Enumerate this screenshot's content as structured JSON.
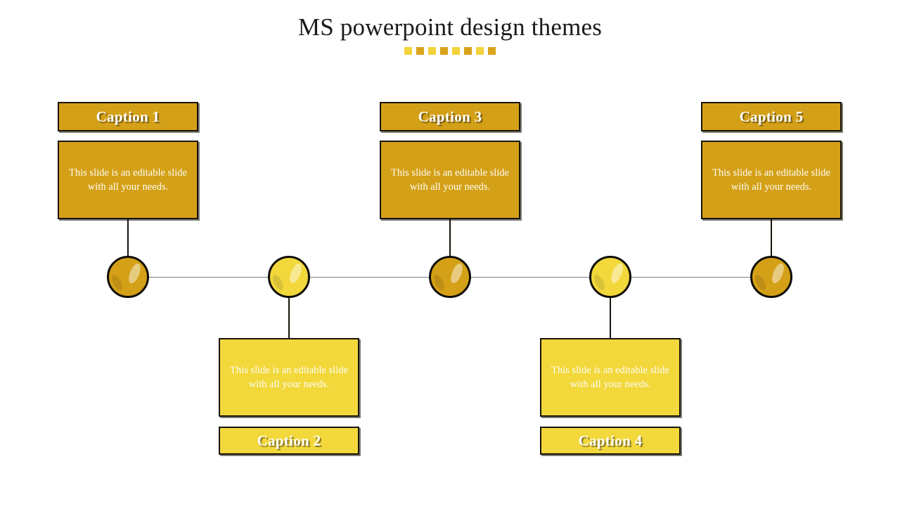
{
  "slide": {
    "title": "MS powerpoint design themes",
    "background": "#FFFFFF",
    "accent_dark": "#D4A017",
    "accent_light": "#F2D83B",
    "outline": "#191407",
    "axis_color": "#7C7C7C",
    "title_color": "#1A1A1A"
  },
  "title_dots": [
    {
      "color": "#F2D33C"
    },
    {
      "color": "#D9A41C"
    },
    {
      "color": "#F2D33C"
    },
    {
      "color": "#D9A41C"
    },
    {
      "color": "#F2D33C"
    },
    {
      "color": "#D9A41C"
    },
    {
      "color": "#F2D33C"
    },
    {
      "color": "#D9A41C"
    }
  ],
  "body_text": "This slide is an editable slide with all your needs.",
  "nodes": [
    {
      "id": "node-1",
      "caption": "Caption 1",
      "body": "This slide is an editable slide with all your needs.",
      "position": "above",
      "tone": "dark",
      "fill": "#D4A017",
      "circle_fill": "#D4A017"
    },
    {
      "id": "node-2",
      "caption": "Caption 2",
      "body": "This slide is an editable slide with all your needs.",
      "position": "below",
      "tone": "light",
      "fill": "#F2D83B",
      "circle_fill": "#F2D83B"
    },
    {
      "id": "node-3",
      "caption": "Caption 3",
      "body": "This slide is an editable slide with all your needs.",
      "position": "above",
      "tone": "dark",
      "fill": "#D4A017",
      "circle_fill": "#D4A017"
    },
    {
      "id": "node-4",
      "caption": "Caption 4",
      "body": "This slide is an editable slide with all your needs.",
      "position": "below",
      "tone": "light",
      "fill": "#F2D83B",
      "circle_fill": "#F2D83B"
    },
    {
      "id": "node-5",
      "caption": "Caption 5",
      "body": "This slide is an editable slide with all your needs.",
      "position": "above",
      "tone": "dark",
      "fill": "#D4A017",
      "circle_fill": "#D4A017"
    }
  ]
}
